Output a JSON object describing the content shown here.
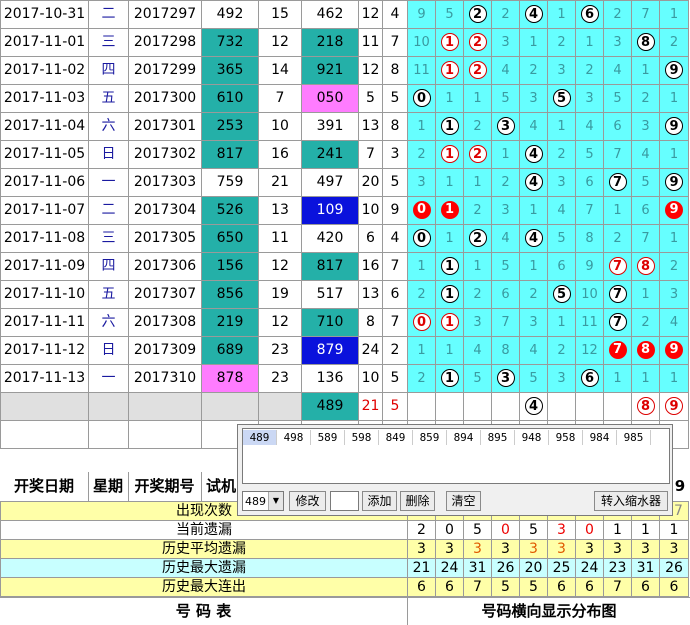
{
  "rows": [
    {
      "date": "2017-10-31",
      "wk": "二",
      "issue": "2017297",
      "n1": "492",
      "s1": "15",
      "n2": "462",
      "s2": "12",
      "sp": "4",
      "c1": "",
      "c2": "",
      "cells": [
        "9",
        "5",
        "b:2",
        "2",
        "b:4",
        "1",
        "b:6",
        "2",
        "7",
        "1"
      ]
    },
    {
      "date": "2017-11-01",
      "wk": "三",
      "issue": "2017298",
      "n1": "732",
      "s1": "12",
      "n2": "218",
      "s2": "11",
      "sp": "7",
      "c1": "teal",
      "c2": "teal",
      "cells": [
        "10",
        "r:1",
        "r:2",
        "3",
        "1",
        "2",
        "1",
        "3",
        "b:8",
        "2"
      ]
    },
    {
      "date": "2017-11-02",
      "wk": "四",
      "issue": "2017299",
      "n1": "365",
      "s1": "14",
      "n2": "921",
      "s2": "12",
      "sp": "8",
      "c1": "teal",
      "c2": "teal",
      "cells": [
        "11",
        "r:1",
        "r:2",
        "4",
        "2",
        "3",
        "2",
        "4",
        "1",
        "b:9"
      ]
    },
    {
      "date": "2017-11-03",
      "wk": "五",
      "issue": "2017300",
      "n1": "610",
      "s1": "7",
      "n2": "050",
      "s2": "5",
      "sp": "5",
      "c1": "teal",
      "c2": "pink",
      "cells": [
        "b:0",
        "1",
        "1",
        "5",
        "3",
        "b:5",
        "3",
        "5",
        "2",
        "1"
      ]
    },
    {
      "date": "2017-11-04",
      "wk": "六",
      "issue": "2017301",
      "n1": "253",
      "s1": "10",
      "n2": "391",
      "s2": "13",
      "sp": "8",
      "c1": "teal",
      "c2": "",
      "cells": [
        "1",
        "b:1",
        "2",
        "b:3",
        "4",
        "1",
        "4",
        "6",
        "3",
        "b:9"
      ]
    },
    {
      "date": "2017-11-05",
      "wk": "日",
      "issue": "2017302",
      "n1": "817",
      "s1": "16",
      "n2": "241",
      "s2": "7",
      "sp": "3",
      "c1": "teal",
      "c2": "teal",
      "cells": [
        "2",
        "r:1",
        "r:2",
        "1",
        "b:4",
        "2",
        "5",
        "7",
        "4",
        "1"
      ]
    },
    {
      "date": "2017-11-06",
      "wk": "一",
      "issue": "2017303",
      "n1": "759",
      "s1": "21",
      "n2": "497",
      "s2": "20",
      "sp": "5",
      "c1": "",
      "c2": "",
      "cells": [
        "3",
        "1",
        "1",
        "2",
        "b:4",
        "3",
        "6",
        "b:7",
        "5",
        "b:9"
      ]
    },
    {
      "date": "2017-11-07",
      "wk": "二",
      "issue": "2017304",
      "n1": "526",
      "s1": "13",
      "n2": "109",
      "s2": "10",
      "sp": "9",
      "c1": "teal",
      "c2": "blue",
      "cells": [
        "f:0",
        "f:1",
        "2",
        "3",
        "1",
        "4",
        "7",
        "1",
        "6",
        "f:9"
      ]
    },
    {
      "date": "2017-11-08",
      "wk": "三",
      "issue": "2017305",
      "n1": "650",
      "s1": "11",
      "n2": "420",
      "s2": "6",
      "sp": "4",
      "c1": "teal",
      "c2": "",
      "cells": [
        "b:0",
        "1",
        "b:2",
        "4",
        "b:4",
        "5",
        "8",
        "2",
        "7",
        "1"
      ]
    },
    {
      "date": "2017-11-09",
      "wk": "四",
      "issue": "2017306",
      "n1": "156",
      "s1": "12",
      "n2": "817",
      "s2": "16",
      "sp": "7",
      "c1": "teal",
      "c2": "teal",
      "cells": [
        "1",
        "b:1",
        "1",
        "5",
        "1",
        "6",
        "9",
        "r:7",
        "r:8",
        "2"
      ]
    },
    {
      "date": "2017-11-10",
      "wk": "五",
      "issue": "2017307",
      "n1": "856",
      "s1": "19",
      "n2": "517",
      "s2": "13",
      "sp": "6",
      "c1": "teal",
      "c2": "",
      "cells": [
        "2",
        "b:1",
        "2",
        "6",
        "2",
        "b:5",
        "10",
        "b:7",
        "1",
        "3"
      ]
    },
    {
      "date": "2017-11-11",
      "wk": "六",
      "issue": "2017308",
      "n1": "219",
      "s1": "12",
      "n2": "710",
      "s2": "8",
      "sp": "7",
      "c1": "teal",
      "c2": "teal",
      "cells": [
        "r:0",
        "r:1",
        "3",
        "7",
        "3",
        "1",
        "11",
        "b:7",
        "2",
        "4"
      ]
    },
    {
      "date": "2017-11-12",
      "wk": "日",
      "issue": "2017309",
      "n1": "689",
      "s1": "23",
      "n2": "879",
      "s2": "24",
      "sp": "2",
      "c1": "teal",
      "c2": "blue",
      "cells": [
        "1",
        "1",
        "4",
        "8",
        "4",
        "2",
        "12",
        "f:7",
        "f:8",
        "f:9"
      ]
    },
    {
      "date": "2017-11-13",
      "wk": "一",
      "issue": "2017310",
      "n1": "878",
      "s1": "23",
      "n2": "136",
      "s2": "10",
      "sp": "5",
      "c1": "pink",
      "c2": "",
      "cells": [
        "2",
        "b:1",
        "5",
        "b:3",
        "5",
        "3",
        "b:6",
        "1",
        "1",
        "1"
      ]
    }
  ],
  "extra_row": {
    "n2": "489",
    "s2": "21",
    "sp": "5",
    "cells": [
      "",
      "",
      "",
      "",
      "b:4",
      "",
      "",
      "",
      "r:8",
      "r:9"
    ]
  },
  "headers": {
    "date": "开奖日期",
    "wk": "星期",
    "issue": "开奖期号",
    "trial": "试机",
    "last": "9"
  },
  "stats": [
    {
      "label": "出现次数",
      "vals": [
        "",
        "",
        "",
        "",
        "",
        "",
        "",
        "",
        "",
        "17"
      ],
      "bg": "syel"
    },
    {
      "label": "当前遗漏",
      "vals": [
        "2",
        "0",
        "5",
        "0",
        "5",
        "3",
        "0",
        "1",
        "1",
        "1"
      ],
      "bg": "slabel",
      "colors": [
        "",
        "",
        "",
        "red",
        "",
        "red",
        "red",
        "",
        "",
        ""
      ]
    },
    {
      "label": "历史平均遗漏",
      "vals": [
        "3",
        "3",
        "3",
        "3",
        "3",
        "3",
        "3",
        "3",
        "3",
        "3"
      ],
      "bg": "syel",
      "colors": [
        "",
        "",
        "orange",
        "",
        "orange",
        "orange",
        "",
        "",
        "",
        ""
      ]
    },
    {
      "label": "历史最大遗漏",
      "vals": [
        "21",
        "24",
        "31",
        "26",
        "20",
        "25",
        "24",
        "23",
        "31",
        "26"
      ],
      "bg": "scyan"
    },
    {
      "label": "历史最大连出",
      "vals": [
        "6",
        "6",
        "7",
        "5",
        "5",
        "6",
        "6",
        "7",
        "6",
        "6"
      ],
      "bg": "syel"
    }
  ],
  "footer": {
    "left": "号 码 表",
    "right": "号码横向显示分布图"
  },
  "panel": {
    "list": [
      "489",
      "498",
      "589",
      "598",
      "849",
      "859",
      "894",
      "895",
      "948",
      "958",
      "984",
      "985"
    ],
    "combo_value": "489",
    "btn_modify": "修改",
    "btn_add": "添加",
    "btn_delete": "删除",
    "btn_clear": "清空",
    "btn_shrink": "转入缩水器"
  }
}
